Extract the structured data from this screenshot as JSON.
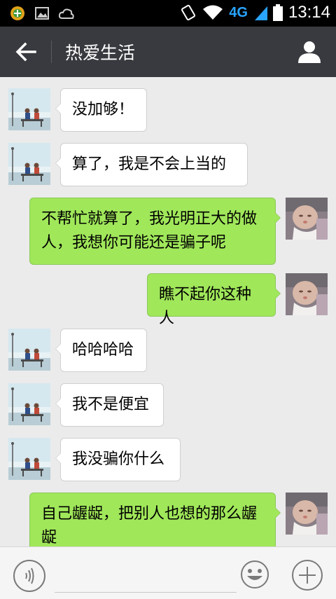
{
  "status_bar": {
    "network": "4G",
    "time": "13:14"
  },
  "header": {
    "title": "热爱生活"
  },
  "messages": [
    {
      "sender": "other",
      "text": "没加够！"
    },
    {
      "sender": "other",
      "text": "算了，我是不会上当的"
    },
    {
      "sender": "me",
      "text": "不帮忙就算了，我光明正大的做人，我想你可能还是骗子呢"
    },
    {
      "sender": "me",
      "text": "瞧不起你这种人"
    },
    {
      "sender": "other",
      "text": "哈哈哈哈"
    },
    {
      "sender": "other",
      "text": "我不是便宜"
    },
    {
      "sender": "other",
      "text": "我没骗你什么"
    },
    {
      "sender": "me",
      "text": "自己龌龊，把别人也想的那么龌龊"
    }
  ],
  "colors": {
    "status_bar": "#000000",
    "title_bar": "#393a3f",
    "chat_background": "#ebebeb",
    "my_bubble": "#a0e75a",
    "other_bubble": "#ffffff",
    "signal_accent": "#29a4ff"
  },
  "icons": {
    "back": "arrow-left-icon",
    "profile": "person-icon",
    "voice": "voice-icon",
    "emoji": "smiley-icon",
    "more": "plus-icon"
  }
}
